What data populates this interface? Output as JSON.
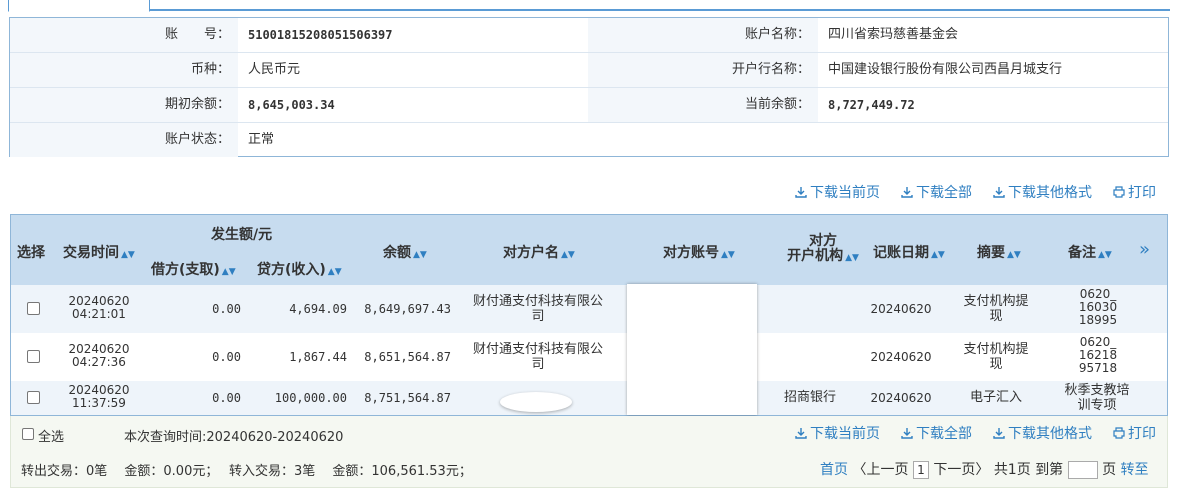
{
  "account": {
    "no_label": "账　　号：",
    "no": "51001815208051506397",
    "name_label": "账户名称：",
    "name": "四川省索玛慈善基金会",
    "currency_label": "币种：",
    "currency": "人民币元",
    "bank_label": "开户行名称：",
    "bank": "中国建设银行股份有限公司西昌月城支行",
    "opening_label": "期初余额：",
    "opening": "8,645,003.34",
    "current_label": "当前余额：",
    "current": "8,727,449.72",
    "status_label": "账户状态：",
    "status": "正常"
  },
  "actions": {
    "download_page": "下载当前页",
    "download_all": "下载全部",
    "download_other": "下载其他格式",
    "print": "打印"
  },
  "table": {
    "headers": {
      "select": "选择",
      "time": "交易时间",
      "amount_group": "发生额/元",
      "debit": "借方(支取)",
      "credit": "贷方(收入)",
      "balance": "余额",
      "counter_name": "对方户名",
      "counter_account": "对方账号",
      "counter_bank_1": "对方",
      "counter_bank_2": "开户机构",
      "post_date": "记账日期",
      "summary": "摘要",
      "remark": "备注",
      "more": "»"
    },
    "rows": [
      {
        "date": "20240620",
        "time": "04:21:01",
        "debit": "0.00",
        "credit": "4,694.09",
        "balance": "8,649,697.43",
        "name1": "财付通支付科技有限公",
        "name2": "司",
        "bank": "",
        "post": "20240620",
        "sum1": "支付机构提",
        "sum2": "现",
        "rem1": "0620_",
        "rem2": "16030",
        "rem3": "18995"
      },
      {
        "date": "20240620",
        "time": "04:27:36",
        "debit": "0.00",
        "credit": "1,867.44",
        "balance": "8,651,564.87",
        "name1": "财付通支付科技有限公",
        "name2": "司",
        "bank": "",
        "post": "20240620",
        "sum1": "支付机构提",
        "sum2": "现",
        "rem1": "0620_",
        "rem2": "16218",
        "rem3": "95718"
      },
      {
        "date": "20240620",
        "time": "11:37:59",
        "debit": "0.00",
        "credit": "100,000.00",
        "balance": "8,751,564.87",
        "name1": "",
        "name2": "",
        "bank": "招商银行",
        "post": "20240620",
        "sum1": "电子汇入",
        "sum2": "",
        "rem1": "秋季支教培",
        "rem2": "训专项",
        "rem3": ""
      }
    ]
  },
  "footer": {
    "select_all": "全选",
    "query_time": "本次查询时间:20240620-20240620",
    "summary": "转出交易：0笔　 金额：0.00元；　 转入交易：3笔　 金额：106,561.53元；"
  },
  "pager": {
    "first": "首页",
    "prev": "〈上一页",
    "current": "1",
    "next": "下一页〉",
    "total": "共1页",
    "goto": "到第",
    "page_unit": "页",
    "jump": "转至"
  }
}
